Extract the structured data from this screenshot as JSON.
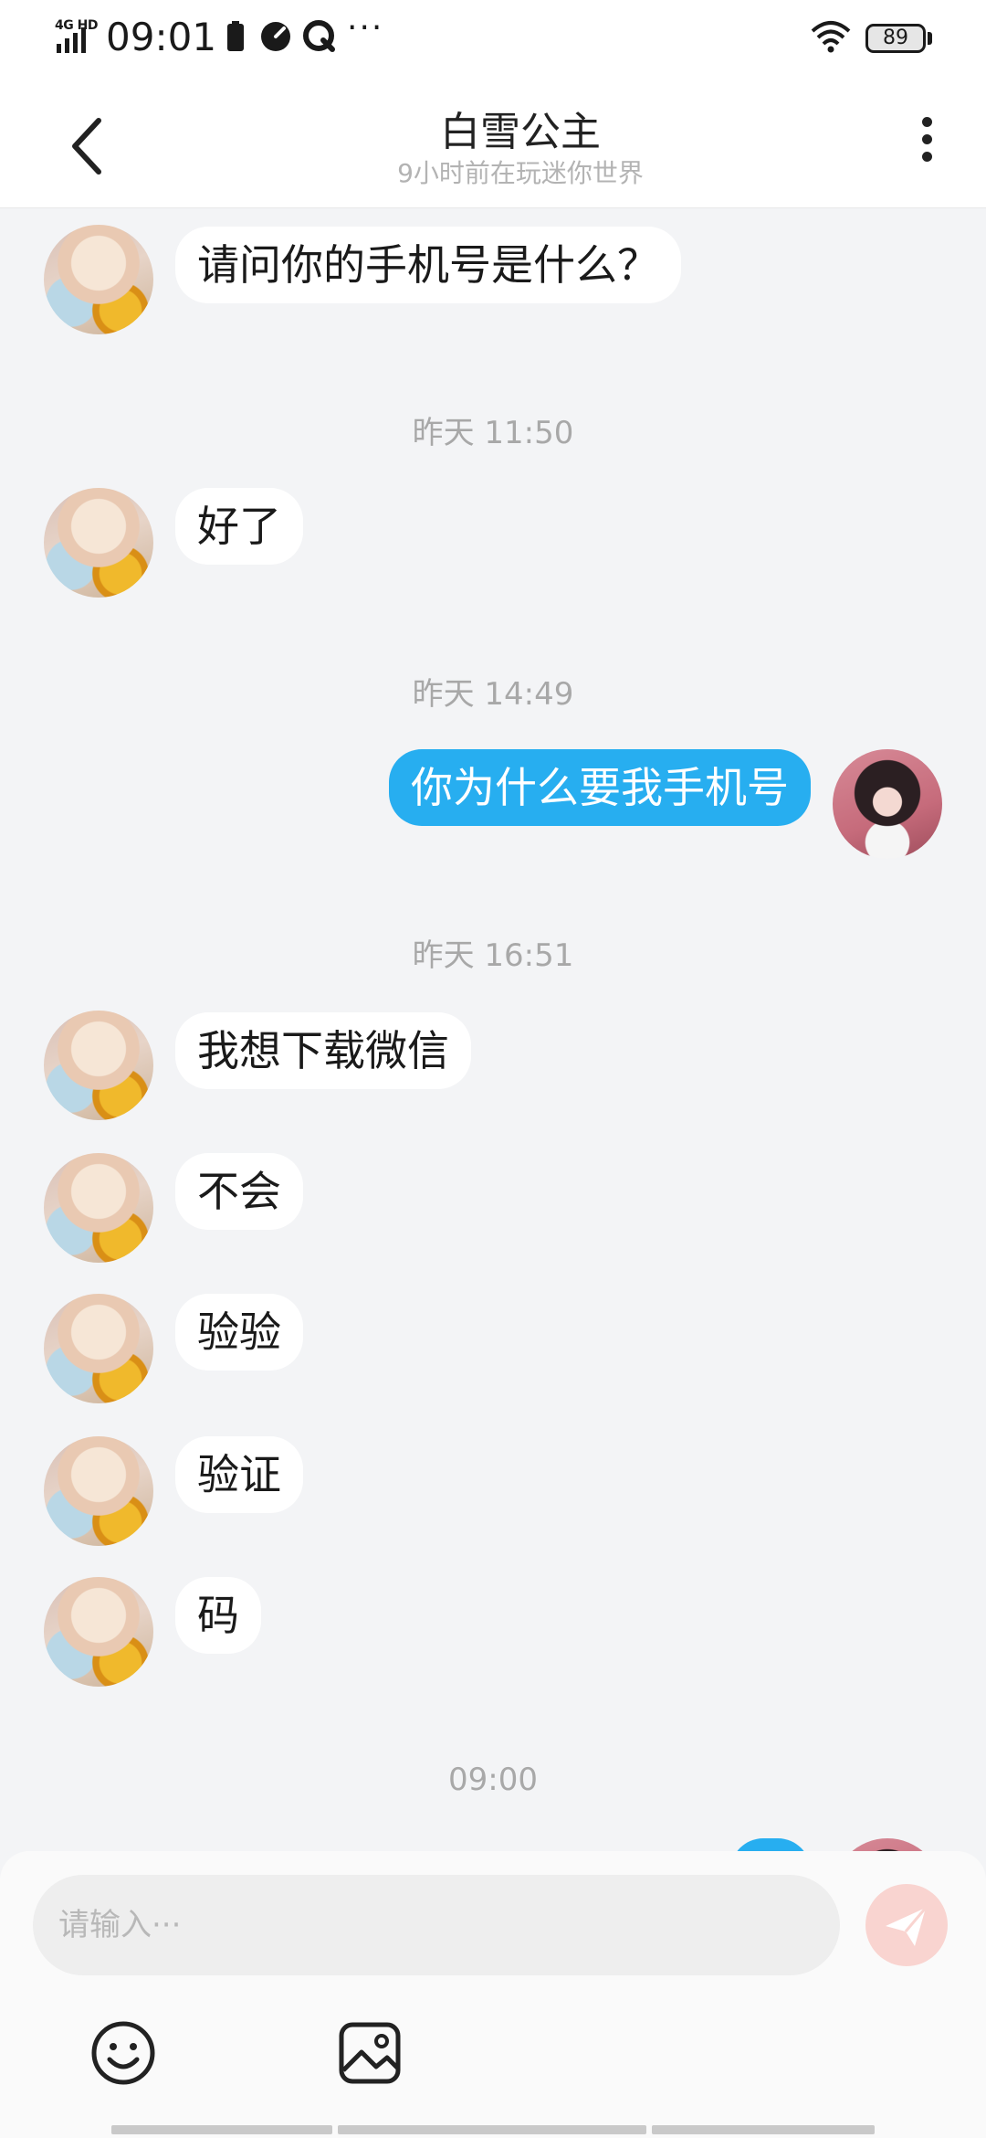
{
  "status_bar": {
    "network": "4G HD",
    "time": "09:01",
    "battery": "89",
    "more": "···"
  },
  "header": {
    "title": "白雪公主",
    "subtitle": "9小时前在玩迷你世界"
  },
  "messages": [
    {
      "type": "bubble",
      "side": "left",
      "text": "请问你的手机号是什么？"
    },
    {
      "type": "time",
      "text": "昨天 11:50"
    },
    {
      "type": "bubble",
      "side": "left",
      "text": "好了"
    },
    {
      "type": "time",
      "text": "昨天 14:49"
    },
    {
      "type": "bubble",
      "side": "right",
      "text": "你为什么要我手机号"
    },
    {
      "type": "time",
      "text": "昨天 16:51"
    },
    {
      "type": "bubble",
      "side": "left",
      "text": "我想下载微信"
    },
    {
      "type": "bubble",
      "side": "left",
      "text": "不会"
    },
    {
      "type": "bubble",
      "side": "left",
      "text": "验验"
    },
    {
      "type": "bubble",
      "side": "left",
      "text": "验证"
    },
    {
      "type": "bubble",
      "side": "left",
      "text": "码"
    },
    {
      "type": "time",
      "text": "09:00"
    }
  ],
  "input": {
    "placeholder": "请输入···"
  },
  "colors": {
    "sent_bubble": "#27aef0",
    "received_bubble": "#ffffff",
    "background": "#f3f4f6",
    "send_button": "#f9d4d0"
  },
  "icons": {
    "back": "chevron-left-icon",
    "more": "vertical-dots-icon",
    "send": "paper-plane-icon",
    "emoji": "smiley-icon",
    "image": "image-icon"
  }
}
